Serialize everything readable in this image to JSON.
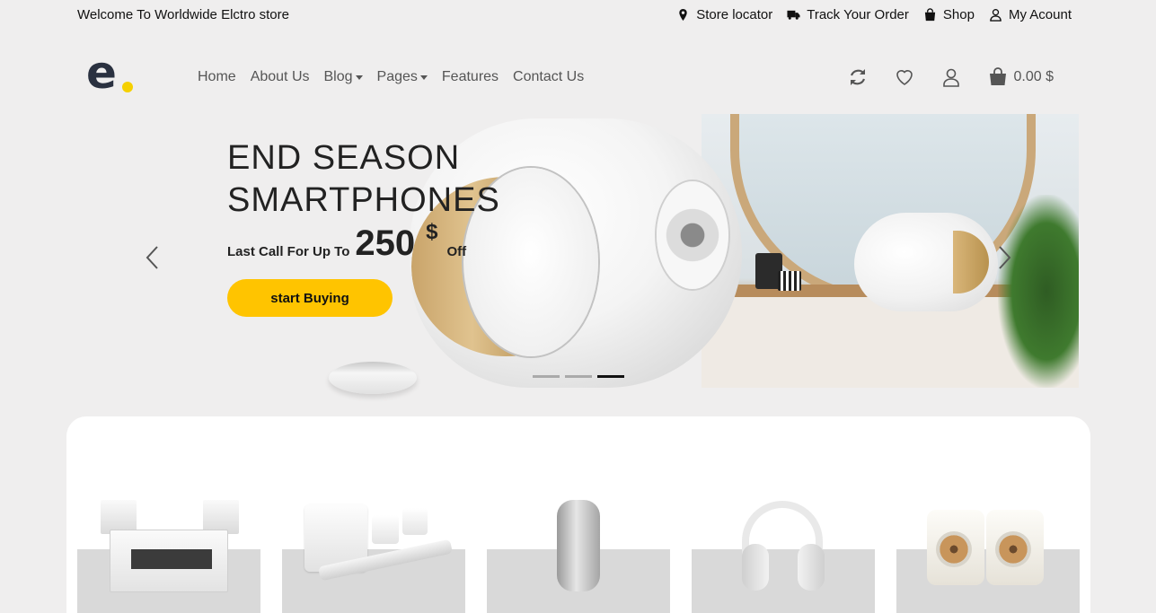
{
  "topbar": {
    "welcome": "Welcome To Worldwide Elctro store",
    "links": [
      {
        "label": "Store locator",
        "icon": "map-marker-icon"
      },
      {
        "label": "Track Your Order",
        "icon": "truck-icon"
      },
      {
        "label": "Shop",
        "icon": "shopping-bag-icon"
      },
      {
        "label": "My Acount",
        "icon": "user-icon"
      }
    ]
  },
  "header": {
    "logo_text": "e",
    "nav": [
      {
        "label": "Home",
        "dropdown": false
      },
      {
        "label": "About Us",
        "dropdown": false
      },
      {
        "label": "Blog",
        "dropdown": true
      },
      {
        "label": "Pages",
        "dropdown": true
      },
      {
        "label": "Features",
        "dropdown": false
      },
      {
        "label": "Contact Us",
        "dropdown": false
      }
    ],
    "icons": [
      "refresh-icon",
      "heart-icon",
      "user-icon",
      "cart-icon"
    ],
    "cart_total": "0.00 $"
  },
  "hero": {
    "title_line1": "END SEASON",
    "title_line2": "SMARTPHONES",
    "pre_text": "Last Call For Up To",
    "price": "250",
    "currency": "$",
    "off_text": "Off",
    "button_label": "start Buying",
    "slides": 3,
    "active_slide": 3
  },
  "products": [
    {
      "name": "stereo-system"
    },
    {
      "name": "soundbar-system"
    },
    {
      "name": "portable-speaker"
    },
    {
      "name": "headphones"
    },
    {
      "name": "bookshelf-speakers"
    }
  ],
  "colors": {
    "accent": "#ffc400",
    "logo_dot": "#f5d000",
    "logo": "#2a3140",
    "background": "#efeeee"
  }
}
